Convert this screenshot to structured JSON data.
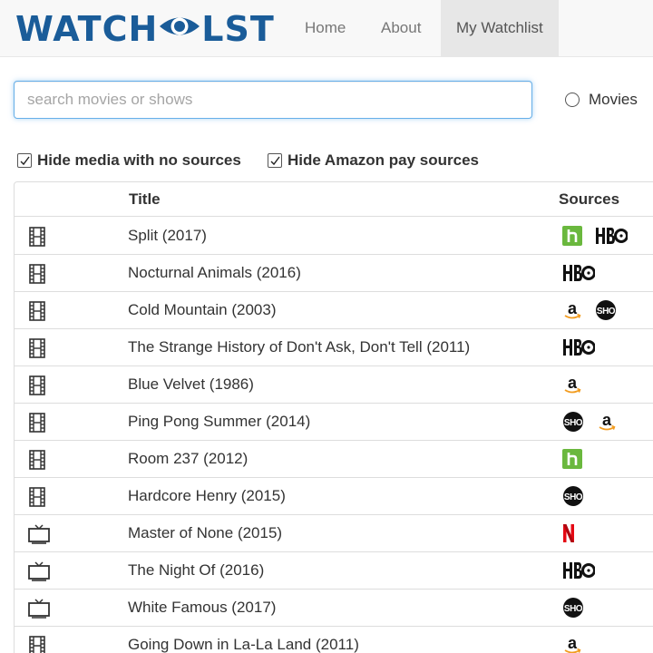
{
  "brand": {
    "text_left": "WATCH",
    "text_right": "LST",
    "color": "#1a5c99"
  },
  "nav": {
    "items": [
      {
        "label": "Home",
        "active": false
      },
      {
        "label": "About",
        "active": false
      },
      {
        "label": "My Watchlist",
        "active": true
      }
    ]
  },
  "search": {
    "placeholder": "search movies or shows",
    "value": ""
  },
  "media_type": {
    "label": "Movies",
    "checked": false
  },
  "filters": [
    {
      "label": "Hide media with no sources",
      "checked": true
    },
    {
      "label": "Hide Amazon pay sources",
      "checked": true
    }
  ],
  "table": {
    "headers": {
      "title": "Title",
      "sources": "Sources"
    },
    "rows": [
      {
        "type": "film-icon",
        "title": "Split (2017)",
        "sources": [
          "hulu",
          "hbo"
        ]
      },
      {
        "type": "film-icon",
        "title": "Nocturnal Animals (2016)",
        "sources": [
          "hbo"
        ]
      },
      {
        "type": "film-icon",
        "title": "Cold Mountain (2003)",
        "sources": [
          "amazon",
          "showtime"
        ]
      },
      {
        "type": "film-icon",
        "title": "The Strange History of Don't Ask, Don't Tell (2011)",
        "sources": [
          "hbo"
        ]
      },
      {
        "type": "film-icon",
        "title": "Blue Velvet (1986)",
        "sources": [
          "amazon"
        ]
      },
      {
        "type": "film-icon",
        "title": "Ping Pong Summer (2014)",
        "sources": [
          "showtime",
          "amazon"
        ]
      },
      {
        "type": "film-icon",
        "title": "Room 237 (2012)",
        "sources": [
          "hulu"
        ]
      },
      {
        "type": "film-icon",
        "title": "Hardcore Henry (2015)",
        "sources": [
          "showtime"
        ]
      },
      {
        "type": "tv-icon",
        "title": "Master of None (2015)",
        "sources": [
          "netflix"
        ]
      },
      {
        "type": "tv-icon",
        "title": "The Night Of (2016)",
        "sources": [
          "hbo"
        ]
      },
      {
        "type": "tv-icon",
        "title": "White Famous (2017)",
        "sources": [
          "showtime"
        ]
      },
      {
        "type": "film-icon",
        "title": "Going Down in La-La Land (2011)",
        "sources": [
          "amazon"
        ]
      }
    ]
  },
  "colors": {
    "hulu": "#6ab83e",
    "netflix": "#e50914",
    "amazon_smile": "#f29c1f",
    "focus": "#66afe9"
  }
}
